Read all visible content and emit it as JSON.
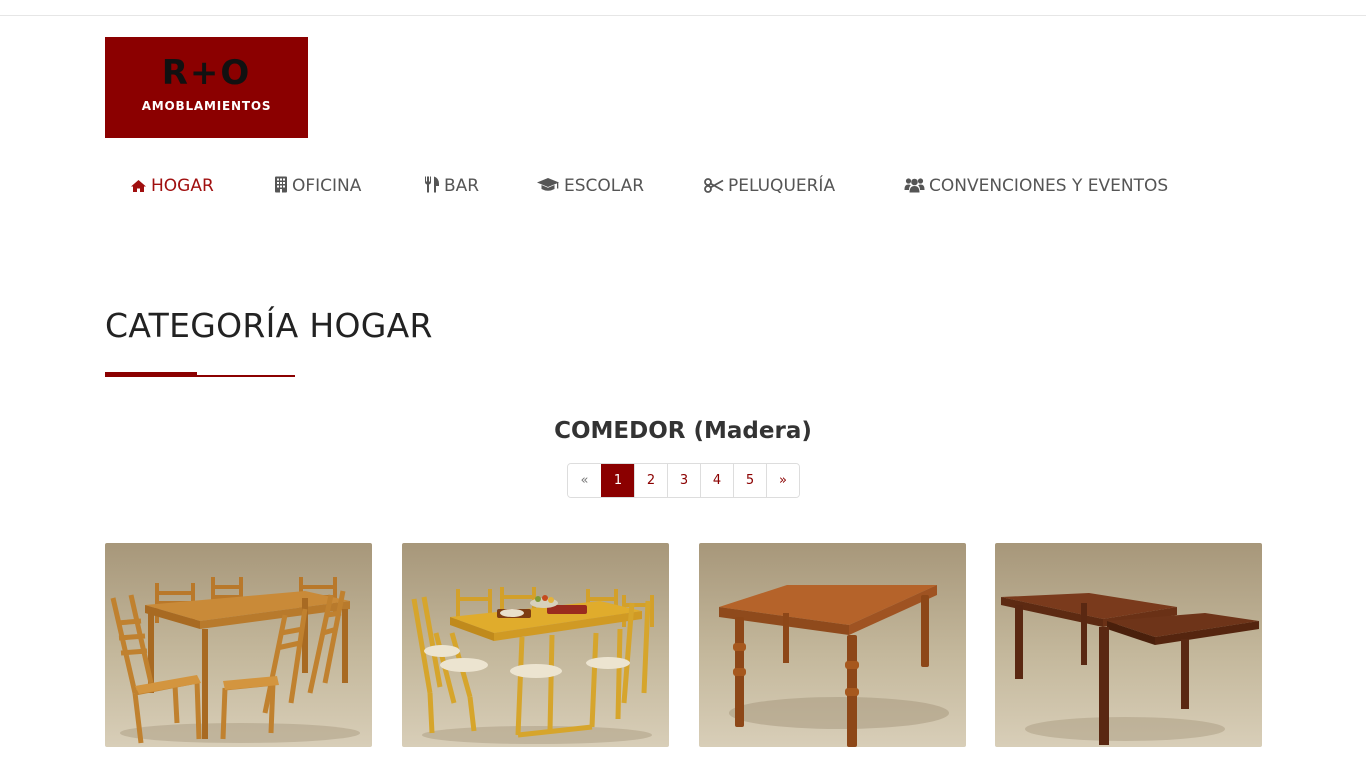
{
  "logo": {
    "line1": "R+O",
    "line2": "AMOBLAMIENTOS"
  },
  "nav": [
    {
      "label": "HOGAR",
      "icon": "home-icon"
    },
    {
      "label": "OFICINA",
      "icon": "building-icon"
    },
    {
      "label": "BAR",
      "icon": "cutlery-icon"
    },
    {
      "label": "ESCOLAR",
      "icon": "graduation-cap-icon"
    },
    {
      "label": "PELUQUERÍA",
      "icon": "scissors-icon"
    },
    {
      "label": "CONVENCIONES Y EVENTOS",
      "icon": "users-icon"
    }
  ],
  "category_title": "CATEGORÍA HOGAR",
  "subcategory_title": "COMEDOR (Madera)",
  "pagination": {
    "prev": "«",
    "pages": [
      "1",
      "2",
      "3",
      "4",
      "5"
    ],
    "next": "»",
    "current": "1"
  },
  "colors": {
    "brand": "#8b0000",
    "nav_active": "#a00f0f",
    "nav_text": "#555555"
  }
}
